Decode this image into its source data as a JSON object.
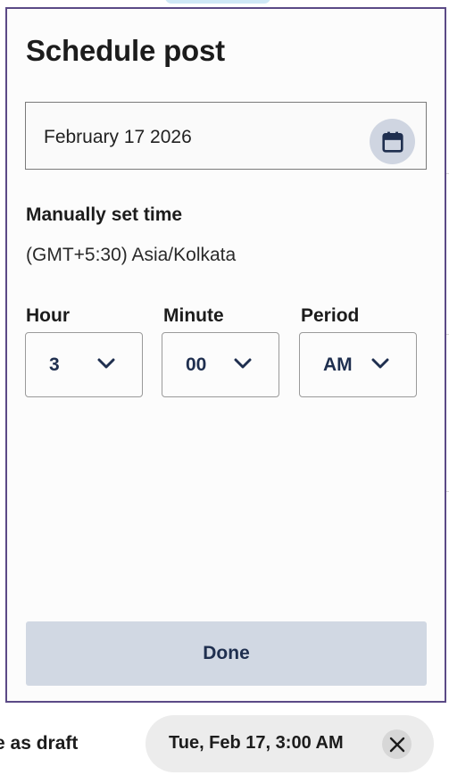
{
  "modal": {
    "title": "Schedule post",
    "date_value": "February 17 2026",
    "manual_label": "Manually set time",
    "timezone": "(GMT+5:30) Asia/Kolkata",
    "selects": [
      {
        "label": "Hour",
        "value": "3"
      },
      {
        "label": "Minute",
        "value": "00"
      },
      {
        "label": "Period",
        "value": "AM"
      }
    ],
    "done_label": "Done"
  },
  "footer": {
    "draft_text": "e as draft",
    "schedule_chip": "Tue, Feb 17, 3:00 AM"
  },
  "colors": {
    "modal_border": "#5b4a86",
    "accent_text": "#1f2f4f",
    "button_bg": "#d1d8e3"
  },
  "icons": {
    "date": "calendar-icon",
    "select": "chevron-down-icon",
    "chip": "close-icon"
  }
}
